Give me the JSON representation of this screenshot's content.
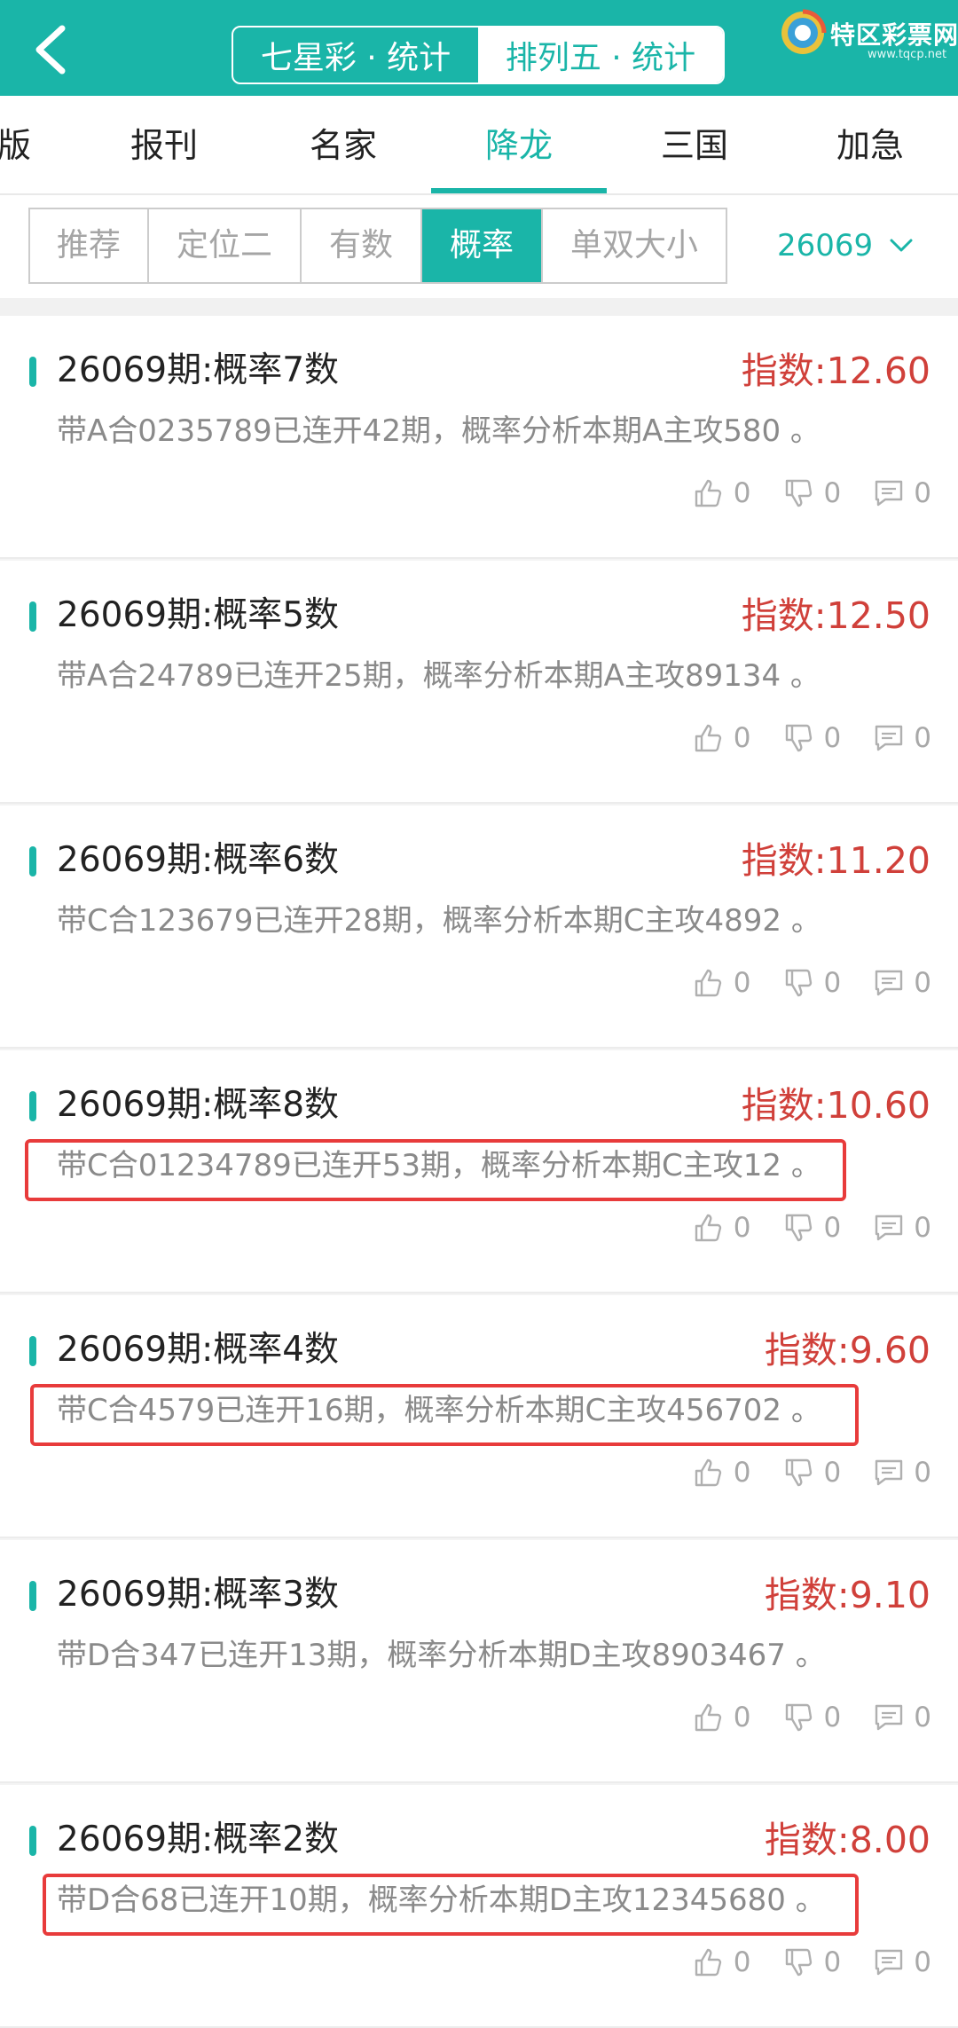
{
  "header": {
    "tabs": [
      {
        "label": "七星彩 · 统计"
      },
      {
        "label": "排列五 · 统计"
      }
    ],
    "brand": {
      "name": "特区彩票网",
      "url": "www.tqcp.net"
    }
  },
  "categories": [
    {
      "label": "版"
    },
    {
      "label": "报刊"
    },
    {
      "label": "名家"
    },
    {
      "label": "降龙"
    },
    {
      "label": "三国"
    },
    {
      "label": "加急"
    }
  ],
  "filters": [
    {
      "label": "推荐"
    },
    {
      "label": "定位二"
    },
    {
      "label": "有数"
    },
    {
      "label": "概率"
    },
    {
      "label": "单双大小"
    }
  ],
  "issue": "26069",
  "cards": [
    {
      "title": "26069期:概率7数",
      "index": "指数:12.60",
      "desc": "带A合0235789已连开42期，概率分析本期A主攻580 。",
      "likes": "0",
      "dislikes": "0",
      "comments": "0"
    },
    {
      "title": "26069期:概率5数",
      "index": "指数:12.50",
      "desc": "带A合24789已连开25期，概率分析本期A主攻89134 。",
      "likes": "0",
      "dislikes": "0",
      "comments": "0"
    },
    {
      "title": "26069期:概率6数",
      "index": "指数:11.20",
      "desc": "带C合123679已连开28期，概率分析本期C主攻4892 。",
      "likes": "0",
      "dislikes": "0",
      "comments": "0"
    },
    {
      "title": "26069期:概率8数",
      "index": "指数:10.60",
      "desc": "带C合01234789已连开53期，概率分析本期C主攻12 。",
      "likes": "0",
      "dislikes": "0",
      "comments": "0"
    },
    {
      "title": "26069期:概率4数",
      "index": "指数:9.60",
      "desc": "带C合4579已连开16期，概率分析本期C主攻456702 。",
      "likes": "0",
      "dislikes": "0",
      "comments": "0"
    },
    {
      "title": "26069期:概率3数",
      "index": "指数:9.10",
      "desc": "带D合347已连开13期，概率分析本期D主攻8903467 。",
      "likes": "0",
      "dislikes": "0",
      "comments": "0"
    },
    {
      "title": "26069期:概率2数",
      "index": "指数:8.00",
      "desc": "带D合68已连开10期，概率分析本期D主攻12345680 。",
      "likes": "0",
      "dislikes": "0",
      "comments": "0"
    }
  ],
  "colors": {
    "accent": "#1ab5a8",
    "index_red": "#d0403a",
    "highlight_red": "#e83b3b"
  }
}
